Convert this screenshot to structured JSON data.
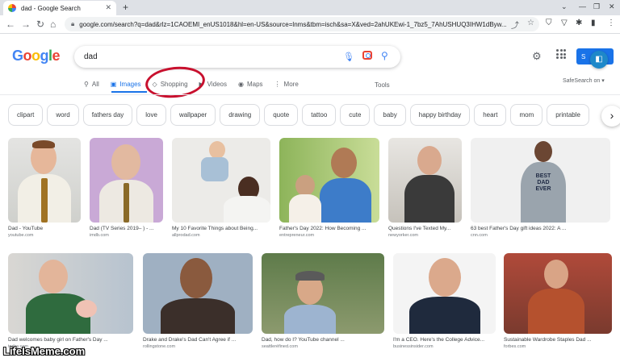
{
  "browser": {
    "tab_title": "dad - Google Search",
    "tab_close": "✕",
    "new_tab": "+",
    "url": "google.com/search?q=dad&rlz=1CAOEMI_enUS1018&hl=en-US&source=lnms&tbm=isch&sa=X&ved=2ahUKEwi-1_7bz5_7AhUSHUQ3IHW1dByw..."
  },
  "google": {
    "logo": "Google",
    "query": "dad",
    "signin_label": "S",
    "safesearch": "SafeSearch on ▾",
    "tools": "Tools"
  },
  "nav_tabs": [
    {
      "icon": "⚲",
      "label": "All"
    },
    {
      "icon": "▣",
      "label": "Images"
    },
    {
      "icon": "◇",
      "label": "Shopping"
    },
    {
      "icon": "▶",
      "label": "Videos"
    },
    {
      "icon": "◉",
      "label": "Maps"
    },
    {
      "icon": "⋮",
      "label": "More"
    }
  ],
  "chips": [
    "clipart",
    "word",
    "fathers day",
    "love",
    "wallpaper",
    "drawing",
    "quote",
    "tattoo",
    "cute",
    "baby",
    "happy birthday",
    "heart",
    "mom",
    "printable"
  ],
  "results": [
    {
      "caption": "Dad - YouTube",
      "source": "youtube.com"
    },
    {
      "caption": "Dad (TV Series 2019– ) - ...",
      "source": "imdb.com"
    },
    {
      "caption": "My 10 Favorite Things about Being...",
      "source": "allprodad.com"
    },
    {
      "caption": "Father's Day 2022: How Becoming ...",
      "source": "entrepreneur.com"
    },
    {
      "caption": "Questions I've Texted My...",
      "source": "newyorker.com"
    },
    {
      "caption": "63 best Father's Day gift ideas 2022: A ...",
      "source": "cnn.com"
    },
    {
      "caption": "Dad welcomes baby girl on Father's Day ...",
      "source": "today.com"
    },
    {
      "caption": "Drake and Drake's Dad Can't Agree if ...",
      "source": "rollingstone.com"
    },
    {
      "caption": "Dad, how do I? YouTube channel ...",
      "source": "seattleréfined.com"
    },
    {
      "caption": "I'm a CEO. Here's the College Advice...",
      "source": "businessinsider.com"
    },
    {
      "caption": "Sustainable Wardrobe Staples Dad ...",
      "source": "forbes.com"
    }
  ],
  "shirt_text": "BEST\nDAD\nEVER",
  "watermark": "LifeIsMeme.com"
}
